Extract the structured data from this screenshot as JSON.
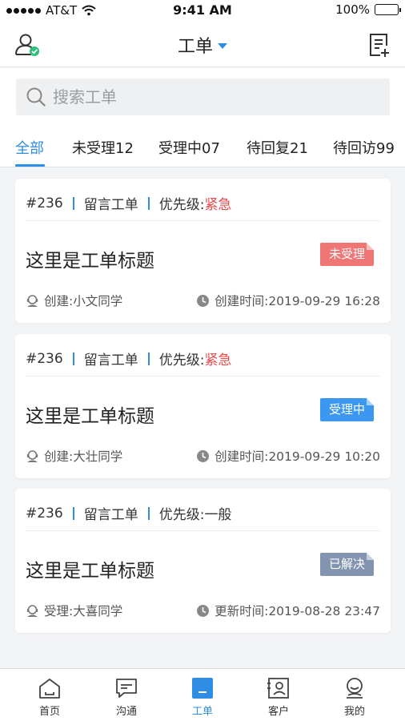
{
  "status_bar": {
    "carrier": "AT&T",
    "time": "9:41 AM",
    "battery": "100%"
  },
  "nav": {
    "title": "工单",
    "left_icon": "user-check-icon",
    "right_icon": "new-order-icon"
  },
  "search": {
    "placeholder": "搜索工单"
  },
  "tabs": [
    {
      "label": "全部",
      "active": true
    },
    {
      "label": "未受理12",
      "active": false
    },
    {
      "label": "受理中07",
      "active": false
    },
    {
      "label": "待回复21",
      "active": false
    },
    {
      "label": "待回访99",
      "active": false
    }
  ],
  "cards": [
    {
      "id": "#236",
      "type": "留言工单",
      "priority_label": "优先级:",
      "priority": "紧急",
      "title": "这里是工单标题",
      "status": "未受理",
      "person": "创建:小文同学",
      "time": "创建时间:2019-09-29 16:28"
    },
    {
      "id": "#236",
      "type": "留言工单",
      "priority_label": "优先级:",
      "priority": "紧急",
      "title": "这里是工单标题",
      "status": "受理中",
      "person": "创建:大壮同学",
      "time": "创建时间:2019-09-29 10:20"
    },
    {
      "id": "#236",
      "type": "留言工单",
      "priority_label": "优先级:",
      "priority": "一般",
      "title": "这里是工单标题",
      "status": "已解决",
      "person": "受理:大喜同学",
      "time": "更新时间:2019-08-28 23:47"
    }
  ],
  "tab_bar": [
    {
      "label": "首页",
      "icon": "home-icon",
      "active": false
    },
    {
      "label": "沟通",
      "icon": "chat-icon",
      "active": false
    },
    {
      "label": "工单",
      "icon": "work-order-icon",
      "active": true
    },
    {
      "label": "客户",
      "icon": "customer-icon",
      "active": false
    },
    {
      "label": "我的",
      "icon": "profile-icon",
      "active": false
    }
  ],
  "colors": {
    "accent": "#2f8de4",
    "urgent": "#e84b4b",
    "status_pending": "#f07575",
    "status_processing": "#3b97ef",
    "status_resolved": "#8294b0"
  }
}
